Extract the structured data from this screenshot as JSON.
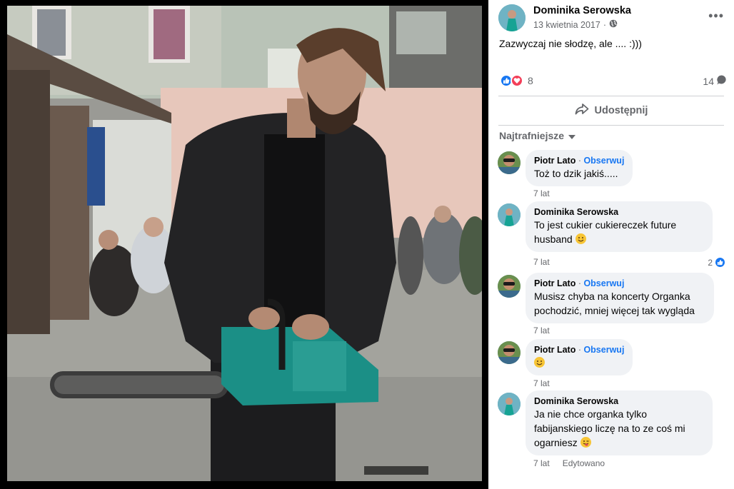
{
  "post": {
    "author": "Dominika Serowska",
    "date": "13 kwietnia 2017",
    "privacy_icon": "globe-icon",
    "text": "Zazwyczaj nie słodzę, ale .... :)))",
    "reaction_count": "8",
    "comment_count": "14",
    "share_label": "Udostępnij"
  },
  "sort_label": "Najtrafniejsze",
  "follow_label": "Obserwuj",
  "comments": [
    {
      "author": "Piotr Lato",
      "text": "Toż to dzik jakiś.....",
      "time": "7 lat"
    },
    {
      "author": "Dominika Serowska",
      "text": "To jest cukier cukiereczek future husband",
      "time": "7 lat",
      "likes": "2"
    },
    {
      "author": "Piotr Lato",
      "text": "Musisz chyba na koncerty Organka pochodzić, mniej więcej tak wygląda",
      "time": "7 lat"
    },
    {
      "author": "Piotr Lato",
      "text": "",
      "time": "7 lat"
    },
    {
      "author": "Dominika Serowska",
      "text": "Ja nie chce organka tylko fabijanskiego liczę na to ze coś mi ogarniesz",
      "time": "7 lat",
      "edited": "Edytowano"
    }
  ],
  "colors": {
    "accent": "#1877f2",
    "love": "#f33e58",
    "bubble": "#f0f2f5",
    "muted": "#65676b"
  }
}
